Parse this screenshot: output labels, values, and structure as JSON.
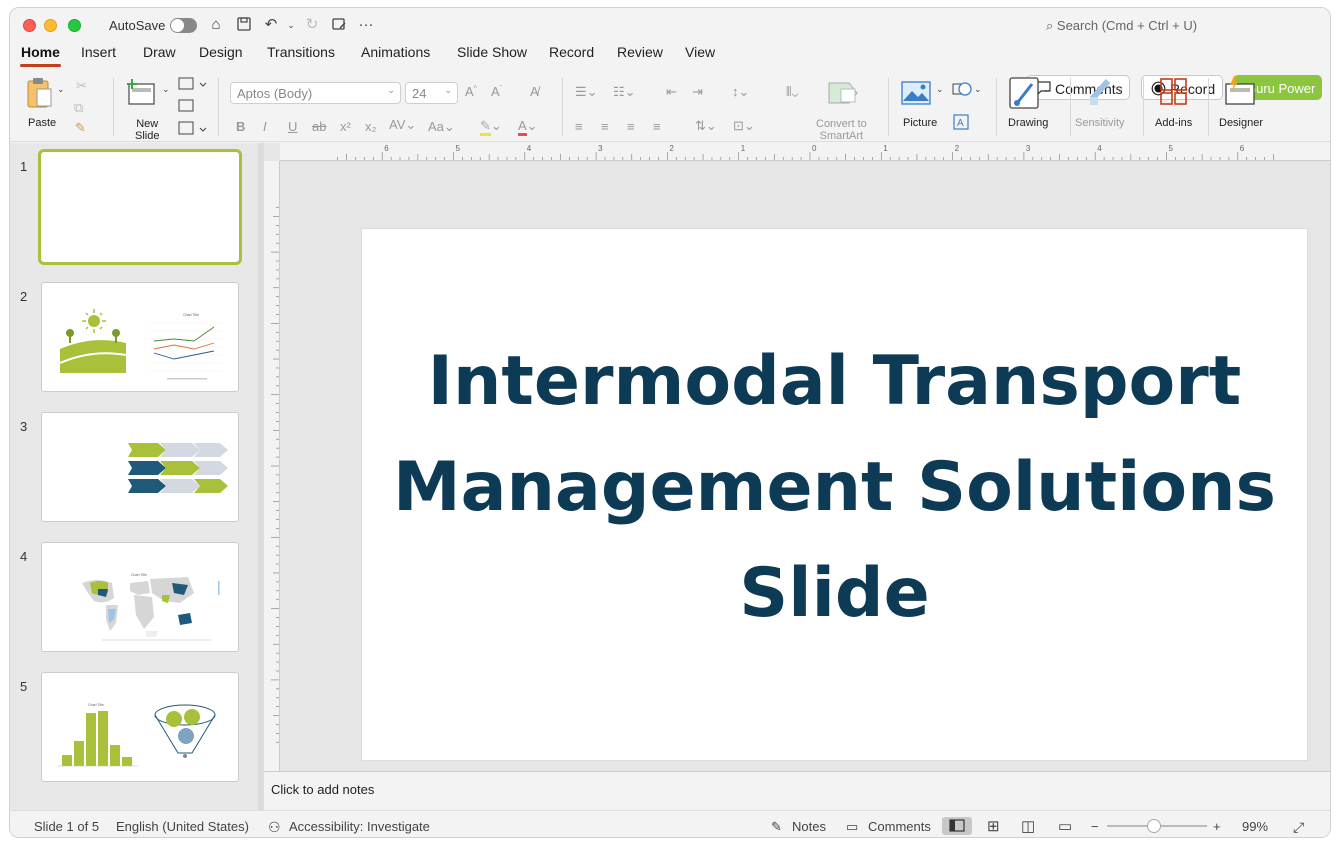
{
  "titlebar": {
    "autosave_label": "AutoSave",
    "search_placeholder": "Search (Cmd + Ctrl + U)"
  },
  "tabs": [
    {
      "label": "Home",
      "active": true
    },
    {
      "label": "Insert"
    },
    {
      "label": "Draw"
    },
    {
      "label": "Design"
    },
    {
      "label": "Transitions"
    },
    {
      "label": "Animations"
    },
    {
      "label": "Slide Show"
    },
    {
      "label": "Record"
    },
    {
      "label": "Review"
    },
    {
      "label": "View"
    }
  ],
  "header_buttons": {
    "comments": "Comments",
    "record": "Record",
    "guru": "Guru Power"
  },
  "ribbon": {
    "paste": "Paste",
    "new_slide": "New\nSlide",
    "font_name": "Aptos (Body)",
    "font_size": "24",
    "convert_smartart": "Convert to\nSmartArt",
    "picture": "Picture",
    "drawing": "Drawing",
    "sensitivity": "Sensitivity",
    "addins": "Add-ins",
    "designer": "Designer"
  },
  "thumbnails": [
    {
      "number": "1"
    },
    {
      "number": "2",
      "chart_title": "Chart Title"
    },
    {
      "number": "3"
    },
    {
      "number": "4",
      "chart_title": "Chart Title"
    },
    {
      "number": "5",
      "chart_title": "Chart Title"
    }
  ],
  "slide": {
    "title": "Intermodal Transport Management Solutions Slide"
  },
  "notes_placeholder": "Click to add notes",
  "status": {
    "slide_count": "Slide 1 of 5",
    "language": "English (United States)",
    "accessibility": "Accessibility: Investigate",
    "notes": "Notes",
    "comments": "Comments",
    "zoom": "99%"
  },
  "colors": {
    "accent": "#c43e1c",
    "title_text": "#0d3a55",
    "green": "#8cc63f",
    "navy": "#1f5a7a"
  }
}
